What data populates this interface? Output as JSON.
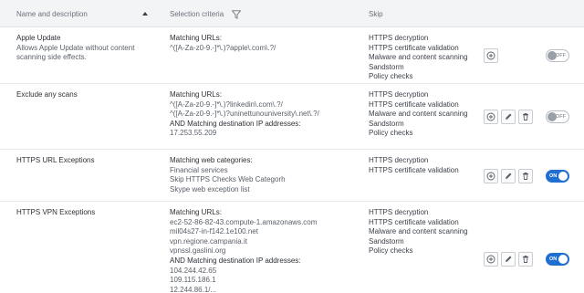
{
  "header": {
    "name_label": "Name and description",
    "criteria_label": "Selection criteria",
    "skip_label": "Skip"
  },
  "rows": [
    {
      "title": "Apple Update",
      "description": "Allows Apple Update without content scanning side effects.",
      "criteria": [
        {
          "label": "Matching URLs:",
          "values": [
            "^([A-Za-z0-9.-]*\\.)?apple\\.com\\.?/"
          ]
        }
      ],
      "skip": [
        "HTTPS decryption",
        "HTTPS certificate validation",
        "Malware and content scanning",
        "Sandstorm",
        "Policy checks"
      ],
      "enabled": false,
      "toggle_text": "OFF"
    },
    {
      "title": "Exclude any scans",
      "description": "",
      "criteria": [
        {
          "label": "Matching URLs:",
          "values": [
            "^([A-Za-z0-9.-]*\\.)?linkedin\\.com\\.?/",
            "^([A-Za-z0-9.-]*\\.)?uninettunouniversity\\.net\\.?/"
          ]
        },
        {
          "label": "AND Matching destination IP addresses:",
          "values": [
            "17.253.55.209"
          ]
        }
      ],
      "skip": [
        "HTTPS decryption",
        "HTTPS certificate validation",
        "Malware and content scanning",
        "Sandstorm",
        "Policy checks"
      ],
      "enabled": false,
      "toggle_text": "OFF"
    },
    {
      "title": "HTTPS URL Exceptions",
      "description": "",
      "criteria": [
        {
          "label": "Matching web categories:",
          "values": [
            "Financial services",
            "Skip HTTPS Checks Web Categorh",
            "Skype web exception list"
          ]
        }
      ],
      "skip": [
        "HTTPS decryption",
        "HTTPS certificate validation"
      ],
      "enabled": true,
      "toggle_text": "ON"
    },
    {
      "title": "HTTPS VPN Exceptions",
      "description": "",
      "criteria": [
        {
          "label": "Matching URLs:",
          "values": [
            "ec2-52-86-82-43.compute-1.amazonaws.com",
            "mil04s27-in-f142.1e100.net",
            "vpn.regione.campania.it",
            "vpnssl.gaslini.org"
          ]
        },
        {
          "label": "AND Matching destination IP addresses:",
          "values": [
            "104.244.42.65",
            "109.115.186.1",
            "12.244.86.1/..."
          ]
        }
      ],
      "skip": [
        "HTTPS decryption",
        "HTTPS certificate validation",
        "Malware and content scanning",
        "Sandstorm",
        "Policy checks"
      ],
      "enabled": true,
      "toggle_text": "ON"
    }
  ],
  "icons": {
    "sort": "sort-ascending-icon",
    "filter": "filter-funnel-icon",
    "copy": "clone-icon",
    "edit": "pencil-icon",
    "delete": "trash-icon"
  },
  "colors": {
    "accent": "#1f6fd1",
    "header_bg": "#f3f4f6",
    "border": "#e6e8eb"
  }
}
